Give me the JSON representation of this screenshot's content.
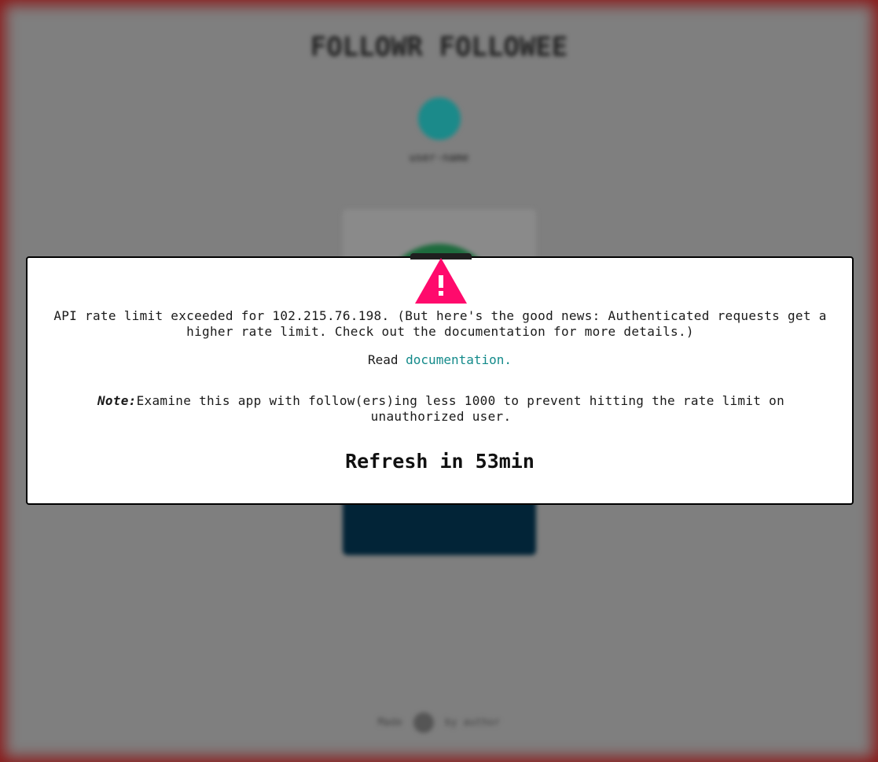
{
  "background": {
    "title": "FOLLOWR FOLLOWEE",
    "username": "user-name",
    "footer_left": "Made",
    "footer_right": "by author"
  },
  "modal": {
    "icon": "warning-triangle-icon",
    "message": "API rate limit exceeded for 102.215.76.198. (But here's the good news: Authenticated requests get a higher rate limit. Check out the documentation for more details.)",
    "read_prefix": "Read",
    "doc_link_label": "documentation.",
    "note_label": "Note:",
    "note_text": "Examine this app with follow(ers)ing less 1000 to prevent hitting the rate limit on unauthorized user.",
    "refresh_text": "Refresh in 53min"
  },
  "colors": {
    "warning": "#ff0a6c",
    "link": "#138a8a",
    "overlay": "#7f7f7f",
    "frame": "#8a1a1a"
  }
}
